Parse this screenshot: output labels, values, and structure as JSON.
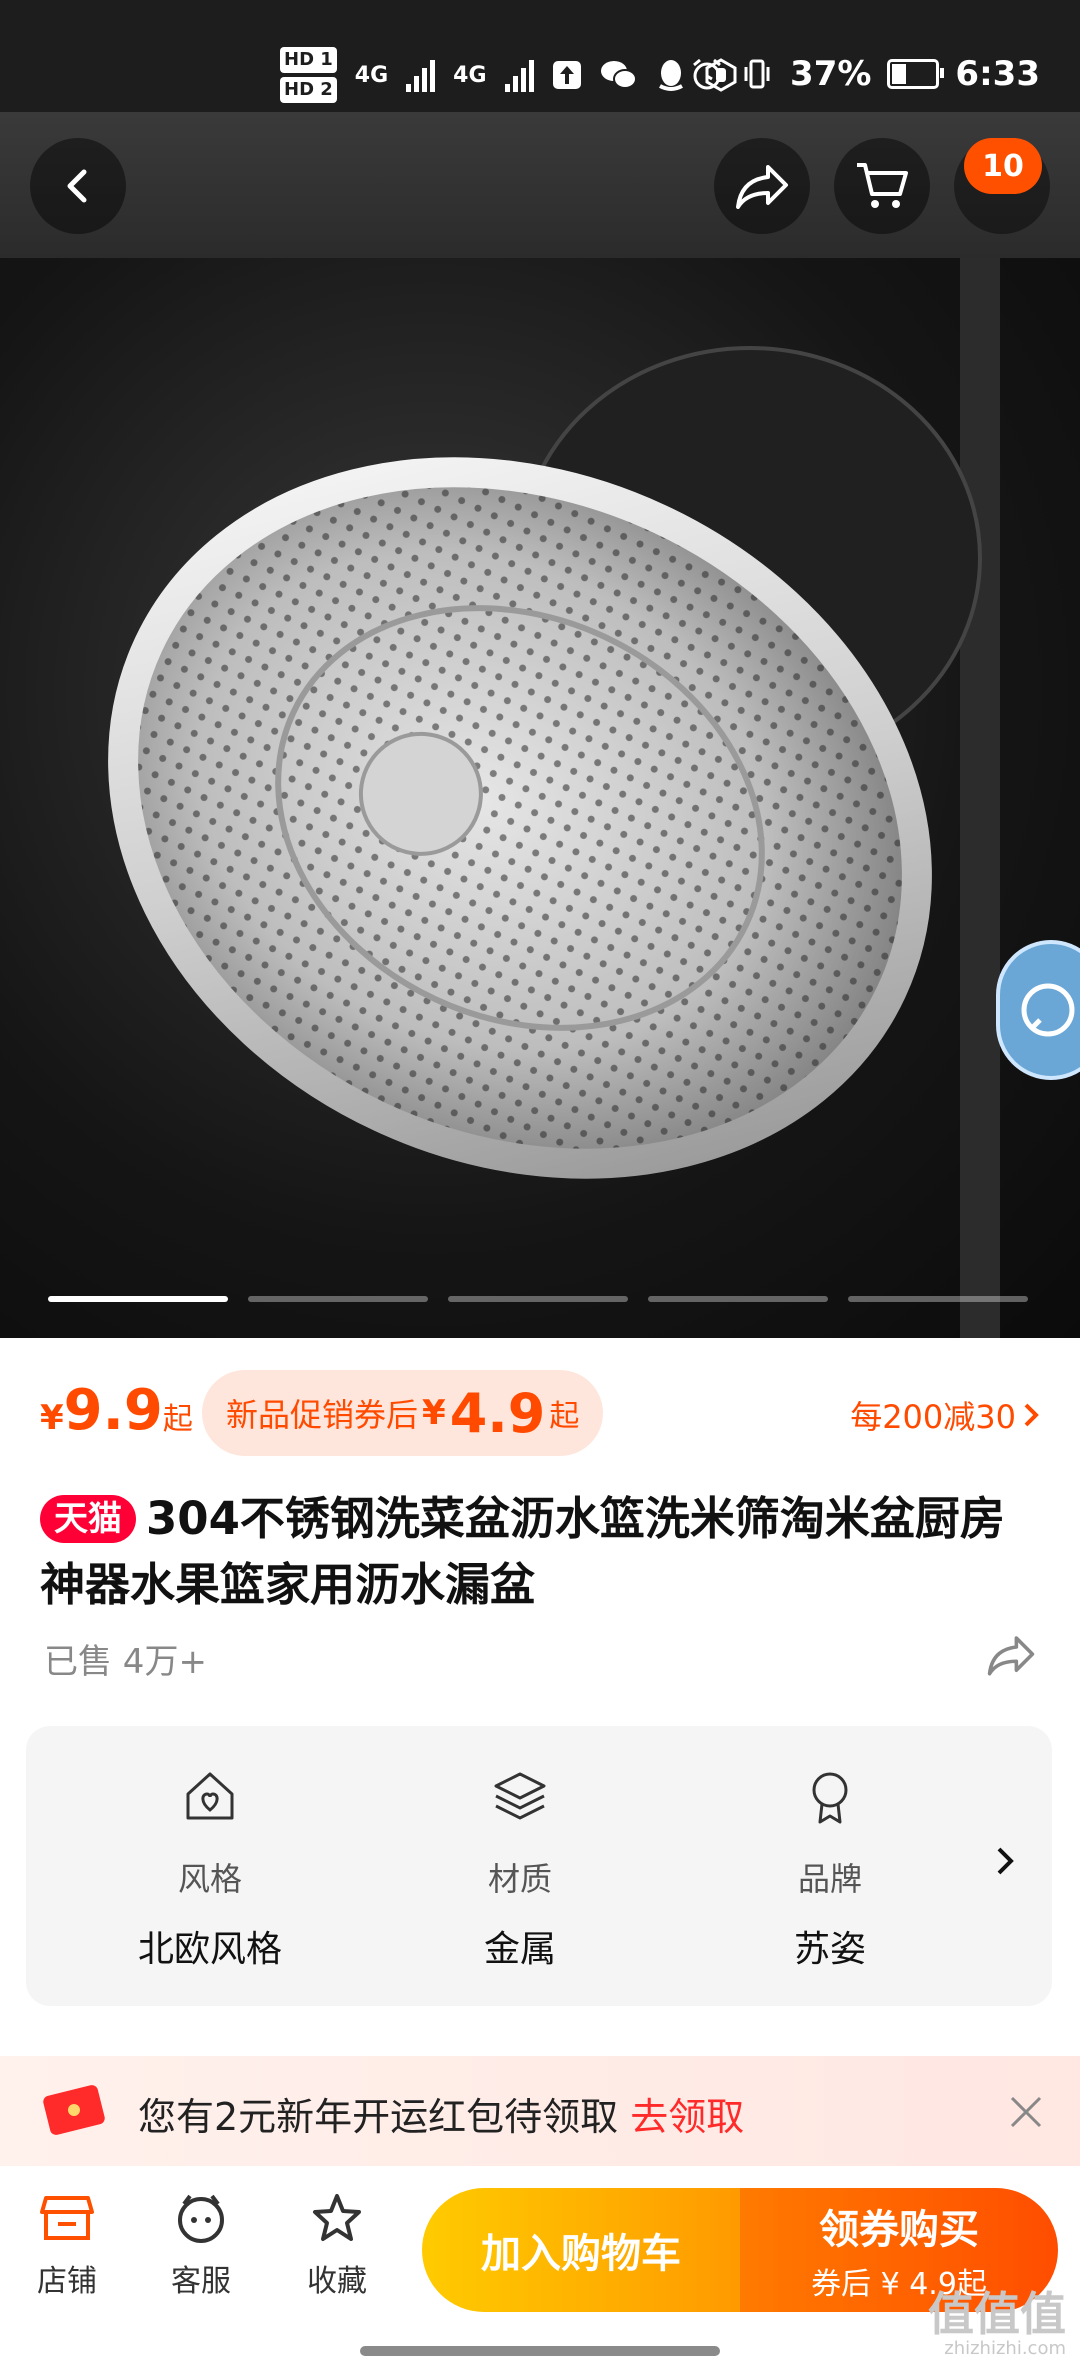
{
  "status_bar": {
    "hd1": "HD 1",
    "hd2": "HD 2",
    "net1": "4G",
    "net2": "4G",
    "battery_percent": "37%",
    "time": "6:33"
  },
  "header": {
    "cart_count": "10"
  },
  "gallery": {
    "image_count": 5,
    "active_index": 0
  },
  "price": {
    "currency": "¥",
    "amount": "9.9",
    "suffix": "起",
    "coupon_label": "新品促销券后",
    "coupon_currency": "¥",
    "coupon_amount": "4.9",
    "coupon_suffix": "起",
    "discount_text": "每200减30"
  },
  "product": {
    "badge": "天猫",
    "title": "304不锈钢洗菜盆沥水篮洗米筛淘米盆厨房神器水果篮家用沥水漏盆",
    "sold": "已售 4万+"
  },
  "attributes": [
    {
      "key": "风格",
      "value": "北欧风格",
      "icon": "house-heart-icon"
    },
    {
      "key": "材质",
      "value": "金属",
      "icon": "layers-icon"
    },
    {
      "key": "品牌",
      "value": "苏姿",
      "icon": "award-icon"
    }
  ],
  "red_packet": {
    "text": "您有2元新年开运红包待领取",
    "link": "去领取"
  },
  "bottom_bar": {
    "shop": "店铺",
    "service": "客服",
    "favorite": "收藏",
    "add_to_cart": "加入购物车",
    "buy_with_coupon": "领券购买",
    "coupon_price": "券后 ¥ 4.9起"
  },
  "watermark": {
    "big": "值值值",
    "small": "zhizhizhi.com"
  },
  "colors": {
    "accent": "#ff5000",
    "tmall_red": "#ff0036",
    "cta_yellow": "#ffb000",
    "cta_orange": "#ff5a00"
  }
}
